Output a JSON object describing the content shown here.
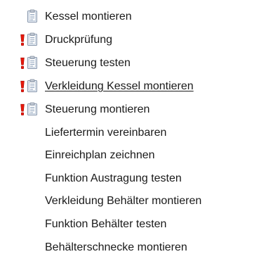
{
  "colors": {
    "priority": "#e8180c",
    "text": "#1a1a1a",
    "background": "#ffffff"
  },
  "tasks": [
    {
      "label": "Kessel montieren",
      "priority_icon": false,
      "task_icon": "clipboard-icon"
    },
    {
      "label": "Druckprüfung",
      "priority_icon": "exclamation-icon",
      "task_icon": "clipboard-icon"
    },
    {
      "label": "Steuerung testen",
      "priority_icon": "exclamation-icon",
      "task_icon": "clipboard-icon"
    },
    {
      "label": "Verkleidung Kessel montieren",
      "priority_icon": "exclamation-icon",
      "task_icon": "clipboard-icon",
      "hovered": true
    },
    {
      "label": "Steuerung montieren",
      "priority_icon": "exclamation-icon",
      "task_icon": "clipboard-icon"
    },
    {
      "label": "Liefertermin vereinbaren",
      "priority_icon": false,
      "task_icon": false
    },
    {
      "label": "Einreichplan zeichnen",
      "priority_icon": false,
      "task_icon": false
    },
    {
      "label": "Funktion Austragung testen",
      "priority_icon": false,
      "task_icon": false
    },
    {
      "label": "Verkleidung Behälter montieren",
      "priority_icon": false,
      "task_icon": false
    },
    {
      "label": "Funktion Behälter testen",
      "priority_icon": false,
      "task_icon": false
    },
    {
      "label": "Behälterschnecke montieren",
      "priority_icon": false,
      "task_icon": false
    }
  ]
}
